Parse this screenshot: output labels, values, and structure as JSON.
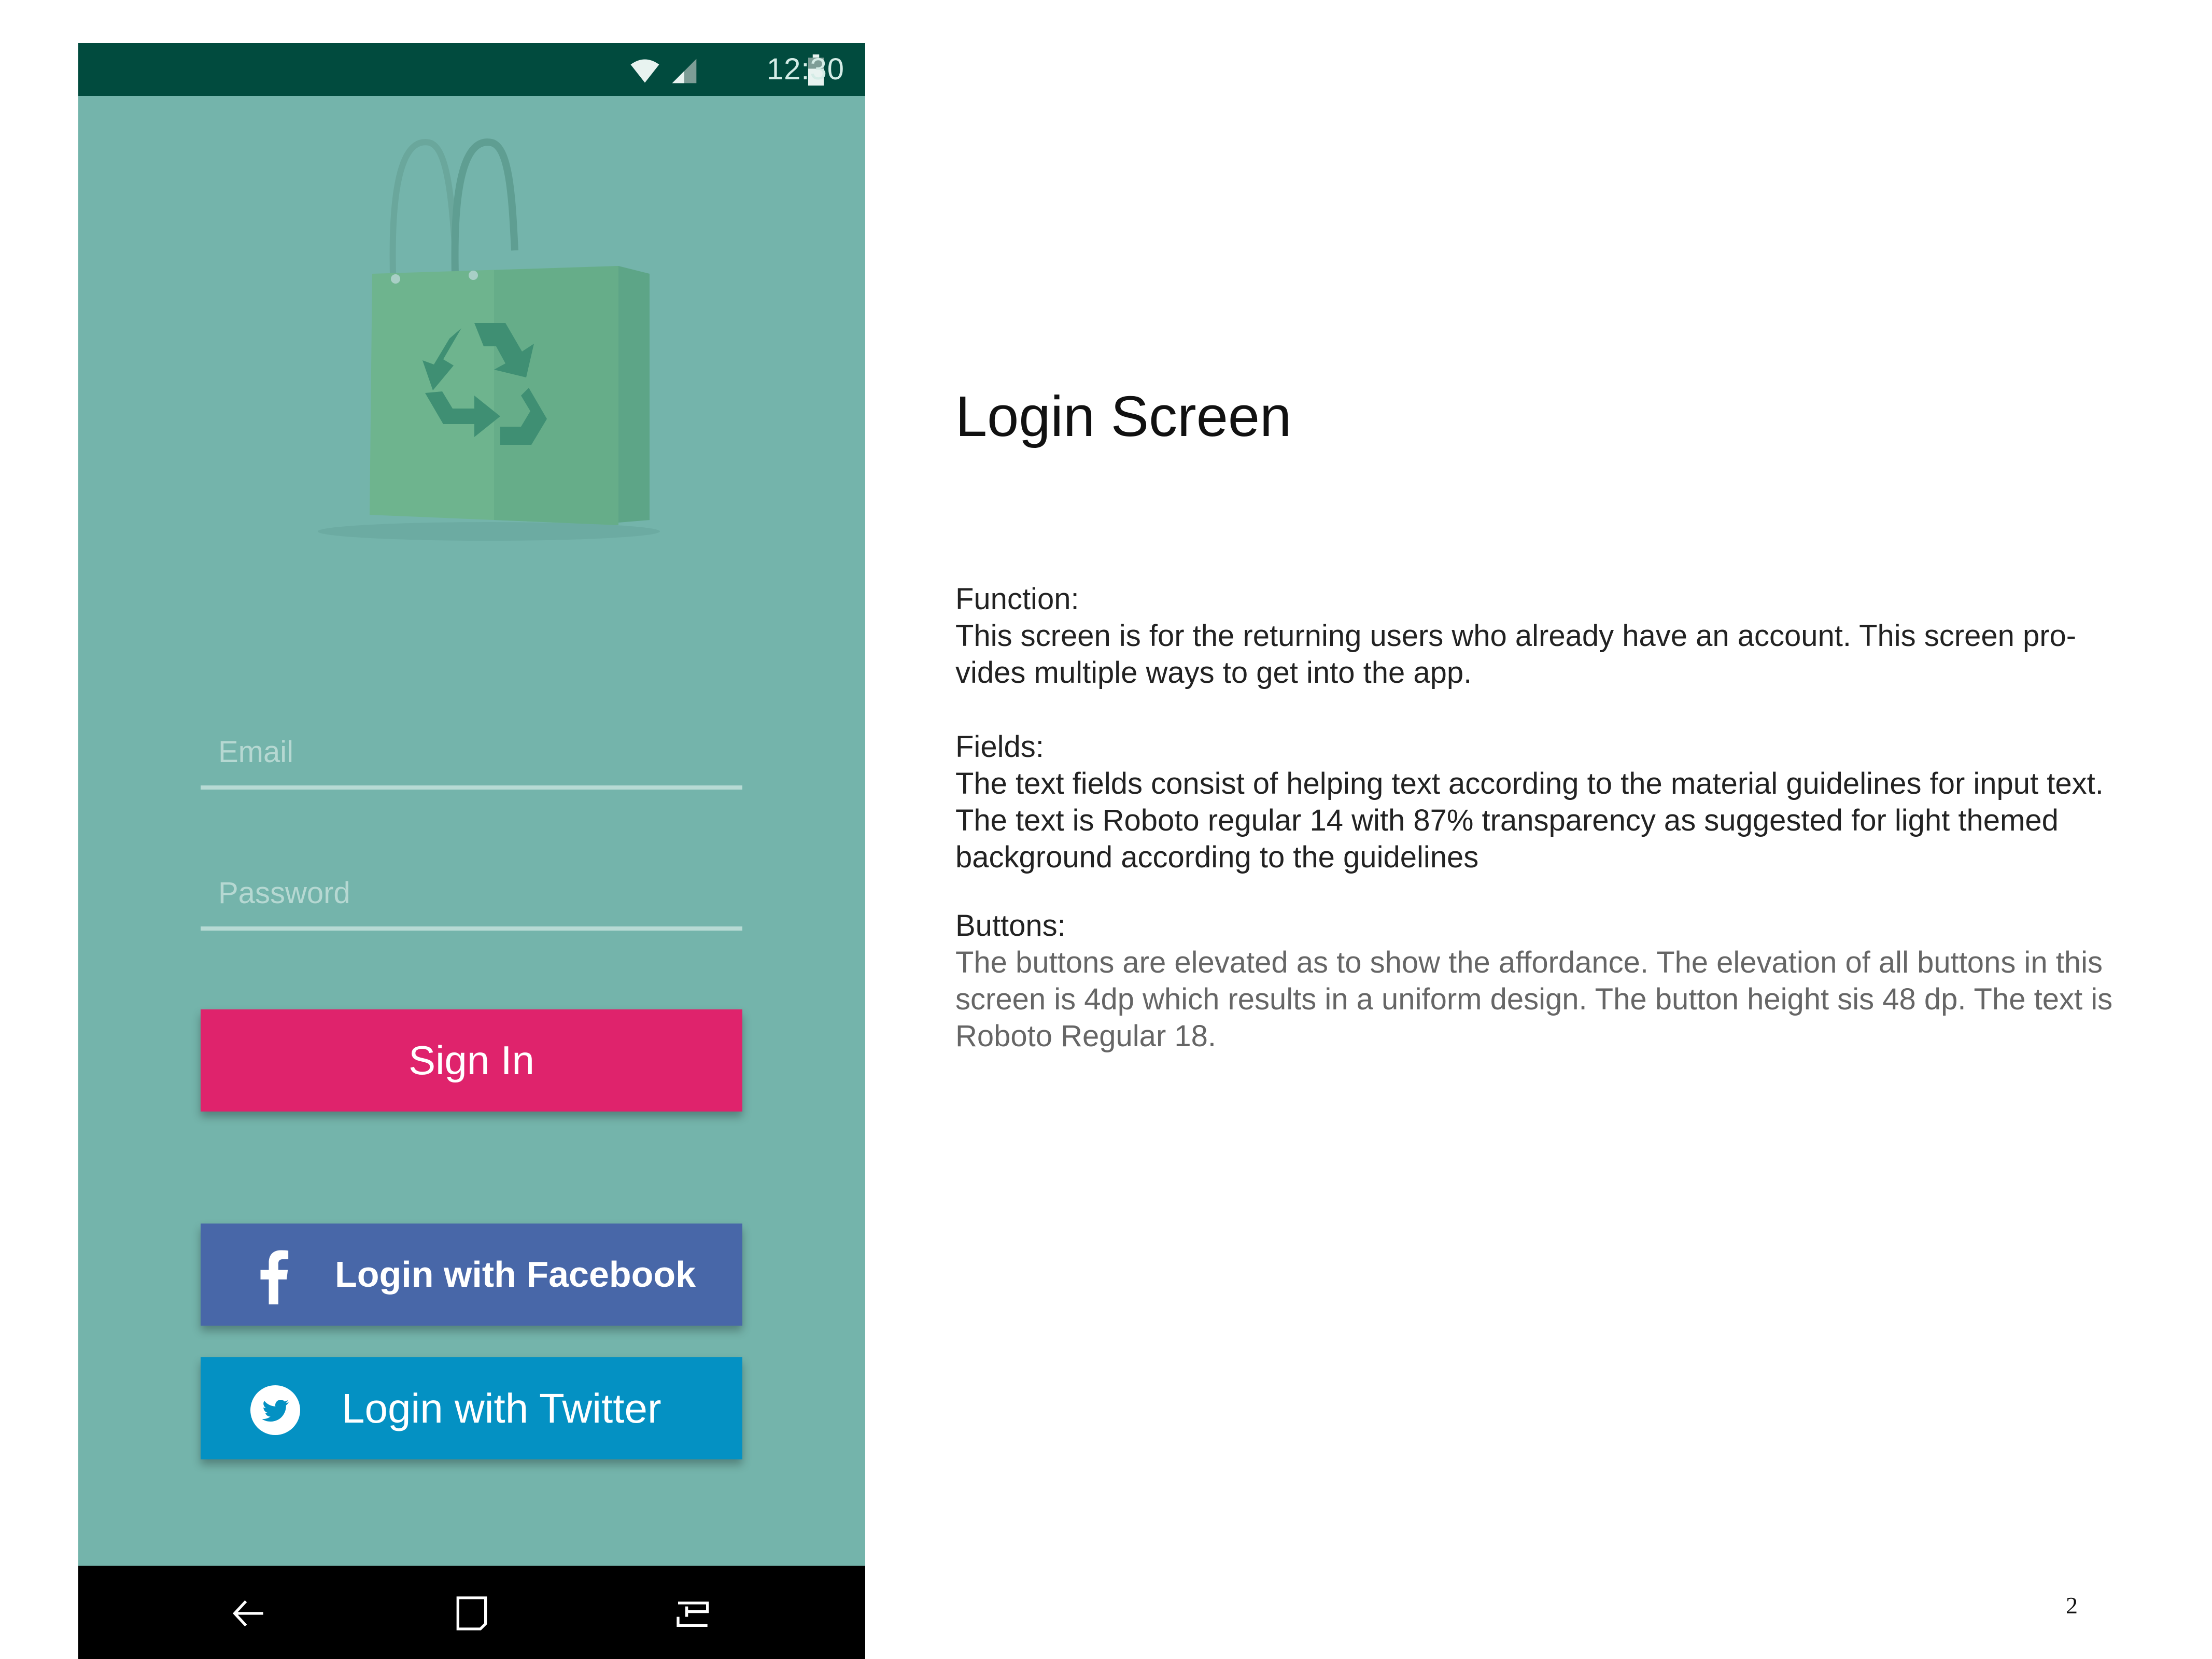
{
  "phone": {
    "status_bar": {
      "time": "12:30",
      "icons": [
        "wifi-icon",
        "signal-icon",
        "battery-icon"
      ]
    },
    "logo": {
      "icon": "shopping-bag-recycle-icon"
    },
    "email_field": {
      "placeholder": "Email"
    },
    "password_field": {
      "placeholder": "Password"
    },
    "sign_in_button": {
      "label": "Sign In"
    },
    "facebook_button": {
      "label": "Login with Facebook",
      "icon": "facebook-icon"
    },
    "twitter_button": {
      "label": "Login with Twitter",
      "icon": "twitter-icon"
    },
    "nav_bar": {
      "icons": [
        "back-icon",
        "home-icon",
        "recents-icon"
      ]
    }
  },
  "description": {
    "title": "Login Screen",
    "sections": [
      {
        "heading": "Function:",
        "lines": [
          "This screen is for the returning users who already have an account. This screen pro-",
          "vides multiple ways to get into the app."
        ]
      },
      {
        "heading": "Fields:",
        "lines": [
          "The text fields consist of helping text according to the material guidelines for input text.",
          "The text is Roboto regular 14 with 87% transparency as suggested for light themed",
          "background according to the guidelines"
        ]
      },
      {
        "heading": "Buttons:",
        "lines": [
          "The buttons are elevated as to show the affordance. The elevation of all buttons in this",
          "screen is 4dp which results in a uniform design. The button height sis 48 dp. The text is",
          "Roboto Regular 18."
        ]
      }
    ],
    "page_number": "2"
  },
  "colors": {
    "background": "#74b4ab",
    "status_bar": "#014b3e",
    "sign_in": "#df236c",
    "facebook": "#4867a8",
    "twitter": "#0491c3",
    "nav_bar": "#000000"
  }
}
